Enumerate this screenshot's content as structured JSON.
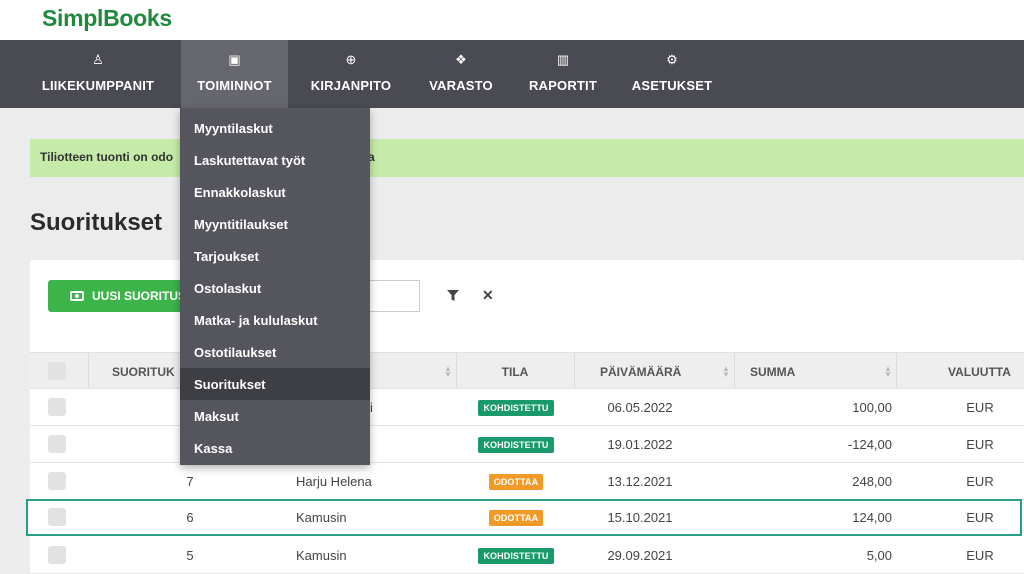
{
  "brand": {
    "logo": "SimplBooks",
    "accent": "#1f8a3c"
  },
  "nav": {
    "items": [
      {
        "label": "LIIKEKUMPPANIT",
        "icon": "person-icon",
        "glyph": "♙"
      },
      {
        "label": "TOIMINNOT",
        "icon": "calculator-icon",
        "glyph": "▣",
        "active": true
      },
      {
        "label": "KIRJANPITO",
        "icon": "briefcase-icon",
        "glyph": "⊕"
      },
      {
        "label": "VARASTO",
        "icon": "boxes-icon",
        "glyph": "❖"
      },
      {
        "label": "RAPORTIT",
        "icon": "bar-chart-icon",
        "glyph": "▥"
      },
      {
        "label": "ASETUKSET",
        "icon": "gear-icon",
        "glyph": "⚙"
      }
    ]
  },
  "dropdown": {
    "items": [
      {
        "label": "Myyntilaskut"
      },
      {
        "label": "Laskutettavat työt"
      },
      {
        "label": "Ennakkolaskut"
      },
      {
        "label": "Myyntitilaukset"
      },
      {
        "label": "Tarjoukset"
      },
      {
        "label": "Ostolaskut"
      },
      {
        "label": "Matka- ja kululaskut"
      },
      {
        "label": "Ostotilaukset"
      },
      {
        "label": "Suoritukset",
        "active": true
      },
      {
        "label": "Maksut"
      },
      {
        "label": "Kassa"
      }
    ]
  },
  "alert": {
    "text_left": "Tiliotteen tuonti on odo",
    "text_right": "a"
  },
  "page": {
    "title": "Suoritukset"
  },
  "toolbar": {
    "new_button_label": "UUSI SUORITUS"
  },
  "table": {
    "headers": {
      "number": "SUORITUK",
      "status": "TILA",
      "date": "PÄIVÄMÄÄRÄ",
      "amount": "SUMMA",
      "currency": "VALUUTTA"
    },
    "rows": [
      {
        "number": "",
        "partner": "i",
        "status": "KOHDISTETTU",
        "status_color": "green",
        "date": "06.05.2022",
        "amount": "100,00",
        "currency": "EUR"
      },
      {
        "number": "",
        "partner": "",
        "status": "KOHDISTETTU",
        "status_color": "green",
        "date": "19.01.2022",
        "amount": "-124,00",
        "currency": "EUR"
      },
      {
        "number": "7",
        "partner": "Harju Helena",
        "status": "ODOTTAA",
        "status_color": "orange",
        "date": "13.12.2021",
        "amount": "248,00",
        "currency": "EUR"
      },
      {
        "number": "6",
        "partner": "Kamusin",
        "status": "ODOTTAA",
        "status_color": "orange",
        "date": "15.10.2021",
        "amount": "124,00",
        "currency": "EUR",
        "highlighted": true
      },
      {
        "number": "5",
        "partner": "Kamusin",
        "status": "KOHDISTETTU",
        "status_color": "green",
        "date": "29.09.2021",
        "amount": "5,00",
        "currency": "EUR"
      }
    ]
  },
  "colors": {
    "status_green": "#1a9a6a",
    "status_orange": "#f29a28",
    "highlight_border": "#27a08a"
  }
}
